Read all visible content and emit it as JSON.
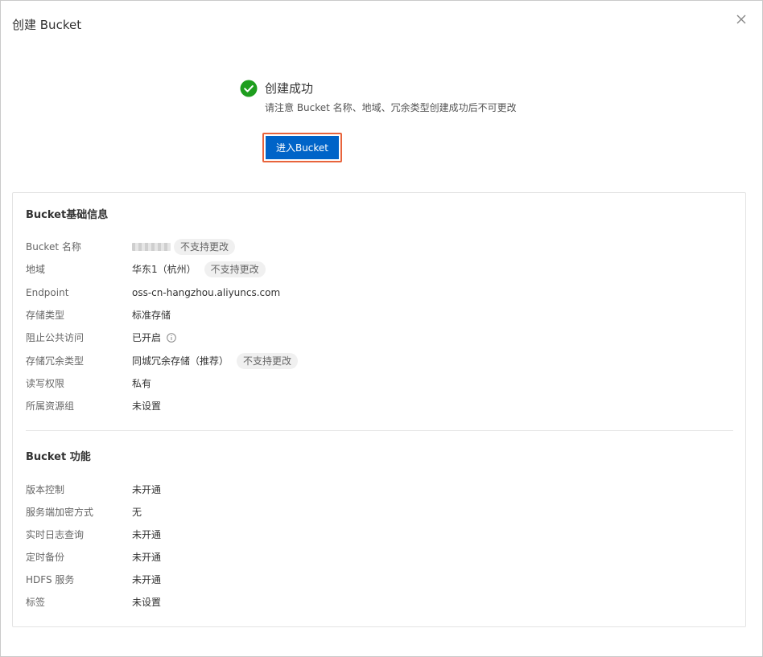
{
  "dialog": {
    "title": "创建 Bucket",
    "close_icon": "close-icon"
  },
  "success": {
    "icon": "check-circle-icon",
    "title": "创建成功",
    "description": "请注意 Bucket 名称、地域、冗余类型创建成功后不可更改",
    "enter_button": "进入Bucket"
  },
  "basic_info": {
    "title": "Bucket基础信息",
    "rows": [
      {
        "label": "Bucket 名称",
        "value": "",
        "tag": "不支持更改"
      },
      {
        "label": "地域",
        "value": "华东1（杭州）",
        "tag": "不支持更改"
      },
      {
        "label": "Endpoint",
        "value": "oss-cn-hangzhou.aliyuncs.com"
      },
      {
        "label": "存储类型",
        "value": "标准存储"
      },
      {
        "label": "阻止公共访问",
        "value": "已开启"
      },
      {
        "label": "存储冗余类型",
        "value": "同城冗余存储（推荐）",
        "tag": "不支持更改"
      },
      {
        "label": "读写权限",
        "value": "私有"
      },
      {
        "label": "所属资源组",
        "value": "未设置"
      }
    ]
  },
  "features": {
    "title": "Bucket 功能",
    "rows": [
      {
        "label": "版本控制",
        "value": "未开通"
      },
      {
        "label": "服务端加密方式",
        "value": "无"
      },
      {
        "label": "实时日志查询",
        "value": "未开通"
      },
      {
        "label": "定时备份",
        "value": "未开通"
      },
      {
        "label": "HDFS 服务",
        "value": "未开通"
      },
      {
        "label": "标签",
        "value": "未设置"
      }
    ]
  },
  "colors": {
    "primary": "#0064c8",
    "success": "#1e9e1e",
    "highlight_border": "#e8643c"
  }
}
